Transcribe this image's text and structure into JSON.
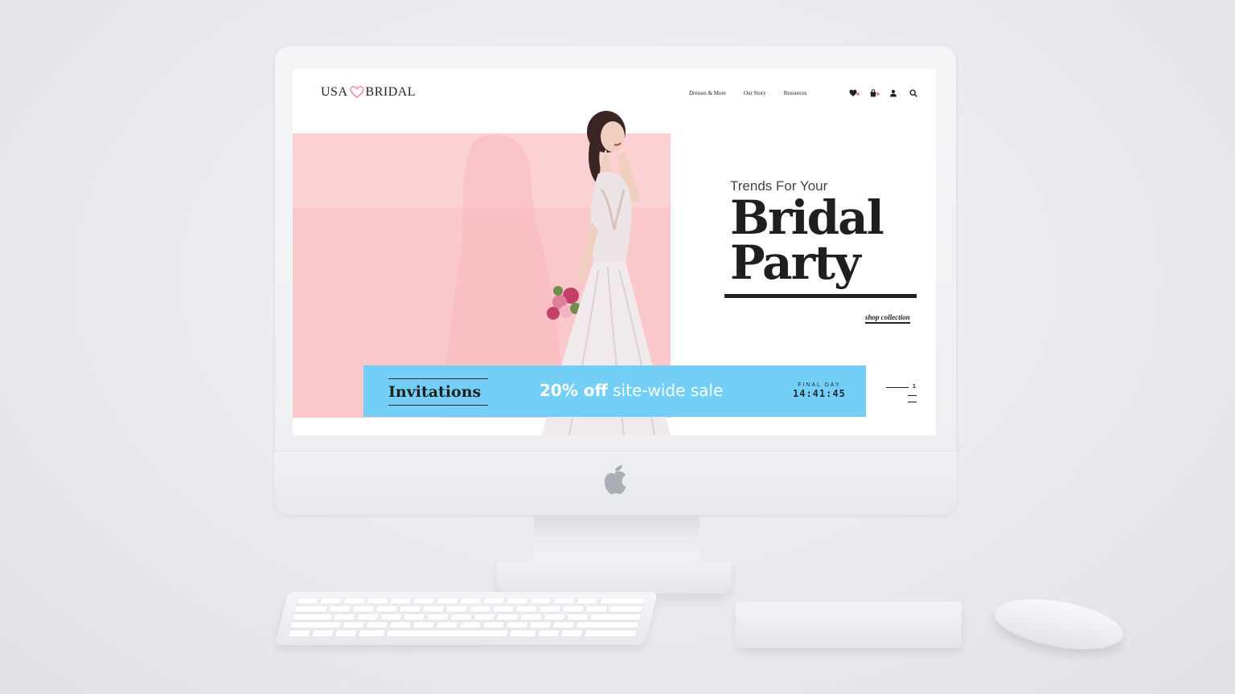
{
  "site": {
    "logo_left": "USA",
    "logo_right": "BRIDAL",
    "nav": [
      "Dresses & More",
      "Our Story",
      "Resources"
    ],
    "icons": [
      "heart-icon",
      "bag-icon",
      "user-icon",
      "search-icon"
    ],
    "badge_color": "#f2879a"
  },
  "hero": {
    "subtitle": "Trends For Your",
    "title_line1": "Bridal",
    "title_line2": "Party",
    "cta": "shop collection",
    "bg_color": "#fac7cb"
  },
  "promo": {
    "label": "Invitations",
    "sale_strong": "20% off",
    "sale_light": "site-wide sale",
    "final_label": "FINAL DAY",
    "countdown": "14:41:45",
    "bg_color": "#74cff7"
  },
  "slider": {
    "current": "1"
  }
}
